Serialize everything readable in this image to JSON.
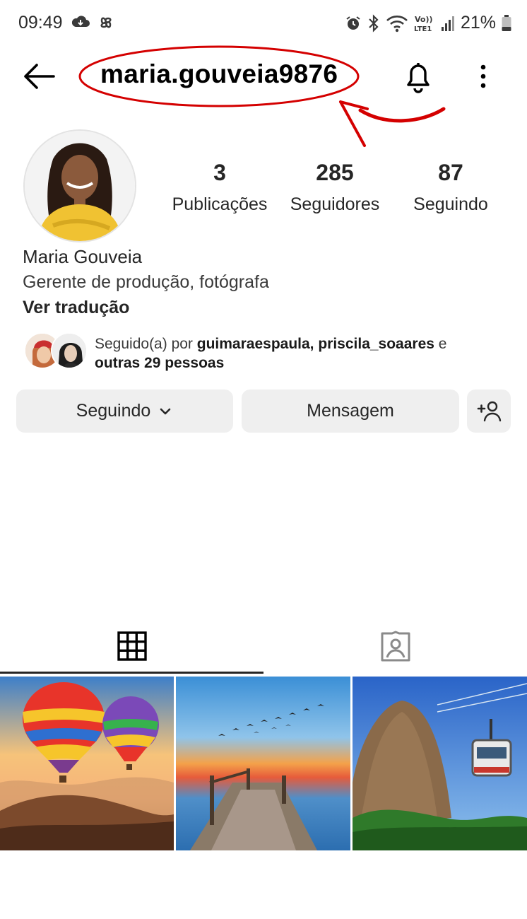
{
  "status_bar": {
    "time": "09:49",
    "battery": "21%",
    "network": "LTE1",
    "icons": [
      "cloud-icon",
      "pinwheel-icon",
      "alarm-icon",
      "bluetooth-icon",
      "wifi-icon",
      "volte-icon",
      "signal-icon",
      "battery-icon"
    ]
  },
  "header": {
    "username": "maria.gouveia9876",
    "back_icon": "arrow-left-icon",
    "notification_icon": "bell-icon",
    "more_icon": "kebab-menu-icon"
  },
  "annotation": {
    "color": "#d40000",
    "shapes": [
      "ellipse",
      "curved-arrow"
    ]
  },
  "profile": {
    "stats": {
      "posts_count": "3",
      "posts_label": "Publicações",
      "followers_count": "285",
      "followers_label": "Seguidores",
      "following_count": "87",
      "following_label": "Seguindo"
    },
    "display_name": "Maria Gouveia",
    "bio": "Gerente de produção, fotógrafa",
    "translate_label": "Ver tradução",
    "followed_by": {
      "prefix": "Seguido(a) por ",
      "names": "guimaraespaula, priscila_soaares",
      "conjunction": " e ",
      "others": "outras 29 pessoas"
    }
  },
  "actions": {
    "following_label": "Seguindo",
    "following_icon": "chevron-down-icon",
    "message_label": "Mensagem",
    "add_user_icon": "add-person-icon"
  },
  "tabs": [
    {
      "name": "posts-grid",
      "icon": "grid-icon",
      "active": true
    },
    {
      "name": "tagged",
      "icon": "tagged-person-icon",
      "active": false
    }
  ],
  "posts": [
    {
      "subject": "hot air balloons at sunset"
    },
    {
      "subject": "wooden pier at sunrise with birds"
    },
    {
      "subject": "Sugarloaf mountain cable car"
    }
  ],
  "colors": {
    "button_bg": "#efefef",
    "text_primary": "#262626",
    "annotation_red": "#d40000"
  }
}
